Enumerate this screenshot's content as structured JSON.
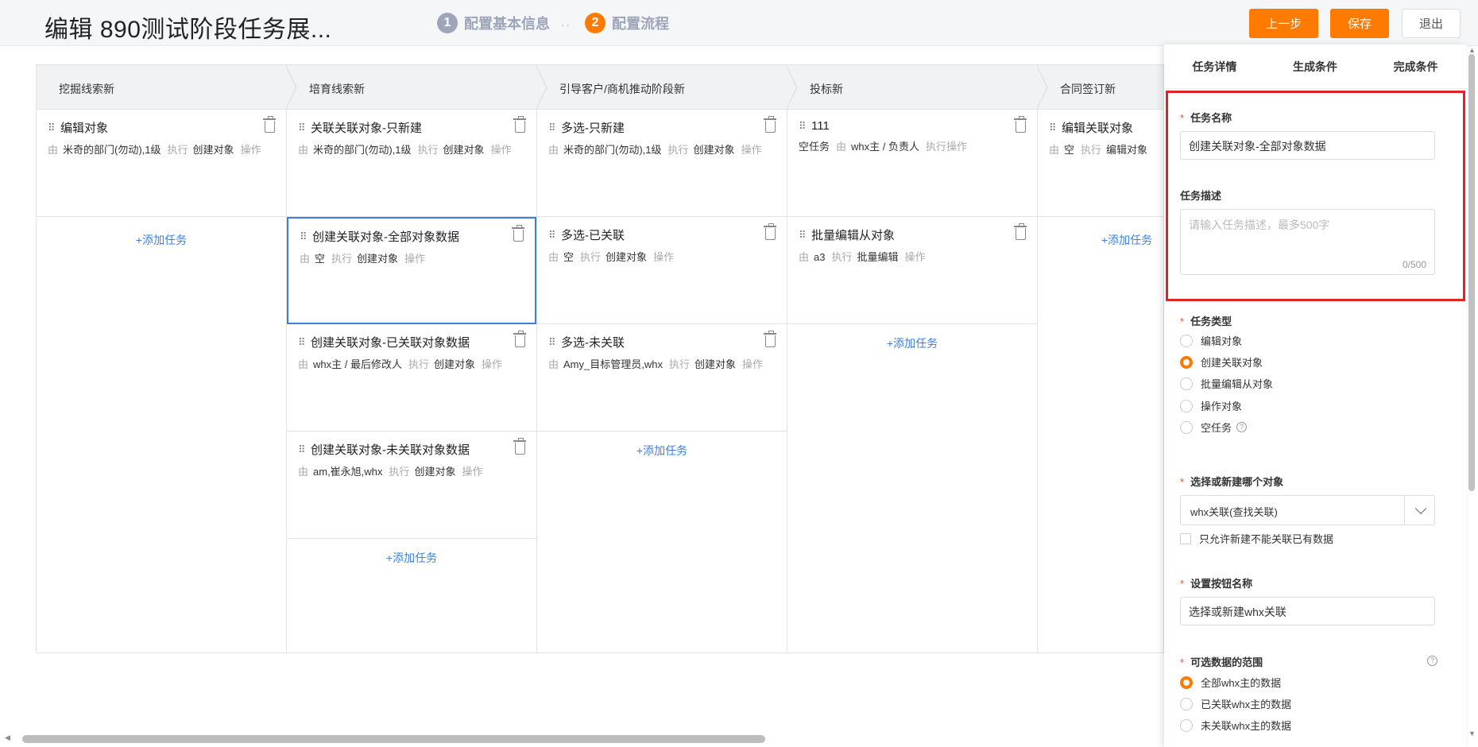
{
  "header": {
    "title": "编辑 890测试阶段任务展...",
    "steps": [
      {
        "num": "1",
        "label": "配置基本信息"
      },
      {
        "num": "2",
        "label": "配置流程"
      }
    ],
    "step_separator": "..",
    "buttons": {
      "prev": "上一步",
      "save": "保存",
      "exit": "退出"
    }
  },
  "board": {
    "add_task_label": "+添加任务",
    "columns": [
      {
        "name": "挖掘线索新",
        "tasks": [
          {
            "title": "编辑对象",
            "by_label": "由",
            "by": "米奇的部门(勿动),1级",
            "exec_label": "执行",
            "action": "创建对象",
            "op_label": "操作"
          }
        ]
      },
      {
        "name": "培育线索新",
        "tasks": [
          {
            "title": "关联关联对象-只新建",
            "by_label": "由",
            "by": "米奇的部门(勿动),1级",
            "exec_label": "执行",
            "action": "创建对象",
            "op_label": "操作"
          },
          {
            "title": "创建关联对象-全部对象数据",
            "by_label": "由",
            "by": "空",
            "exec_label": "执行",
            "action": "创建对象",
            "op_label": "操作"
          },
          {
            "title": "创建关联对象-已关联对象数据",
            "by_label": "由",
            "by": "whx主 / 最后修改人",
            "exec_label": "执行",
            "action": "创建对象",
            "op_label": "操作"
          },
          {
            "title": "创建关联对象-未关联对象数据",
            "by_label": "由",
            "by": "am,崔永旭,whx",
            "exec_label": "执行",
            "action": "创建对象",
            "op_label": "操作"
          }
        ]
      },
      {
        "name": "引导客户/商机推动阶段新",
        "tasks": [
          {
            "title": "多选-只新建",
            "by_label": "由",
            "by": "米奇的部门(勿动),1级",
            "exec_label": "执行",
            "action": "创建对象",
            "op_label": "操作"
          },
          {
            "title": "多选-已关联",
            "by_label": "由",
            "by": "空",
            "exec_label": "执行",
            "action": "创建对象",
            "op_label": "操作"
          },
          {
            "title": "多选-未关联",
            "by_label": "由",
            "by": "Amy_目标管理员,whx",
            "exec_label": "执行",
            "action": "创建对象",
            "op_label": "操作"
          }
        ]
      },
      {
        "name": "投标新",
        "tasks": [
          {
            "title": "111",
            "by_label": "",
            "by": "空任务",
            "exec_label": "由",
            "action": "whx主 / 负责人",
            "op_label": "执行操作"
          },
          {
            "title": "批量编辑从对象",
            "by_label": "由",
            "by": "a3",
            "exec_label": "执行",
            "action": "批量编辑",
            "op_label": "操作"
          }
        ]
      },
      {
        "name": "合同签订新",
        "tasks": [
          {
            "title": "编辑关联对象",
            "by_label": "由",
            "by": "空",
            "exec_label": "执行",
            "action": "编辑对象",
            "op_label": ""
          }
        ]
      }
    ]
  },
  "panel": {
    "tabs": [
      "任务详情",
      "生成条件",
      "完成条件"
    ],
    "task_name": {
      "label": "任务名称",
      "value": "创建关联对象-全部对象数据"
    },
    "task_desc": {
      "label": "任务描述",
      "placeholder": "请输入任务描述，最多500字",
      "counter": "0/500"
    },
    "task_type": {
      "label": "任务类型",
      "options": [
        "编辑对象",
        "创建关联对象",
        "批量编辑从对象",
        "操作对象",
        "空任务"
      ],
      "selected": "创建关联对象"
    },
    "object_select": {
      "label": "选择或新建哪个对象",
      "value": "whx关联(查找关联)",
      "checkbox_label": "只允许新建不能关联已有数据"
    },
    "button_name": {
      "label": "设置按钮名称",
      "value": "选择或新建whx关联"
    },
    "data_range": {
      "label": "可选数据的范围",
      "options": [
        "全部whx主的数据",
        "已关联whx主的数据",
        "未关联whx主的数据"
      ],
      "selected": "全部whx主的数据"
    },
    "required_mark": "*"
  }
}
